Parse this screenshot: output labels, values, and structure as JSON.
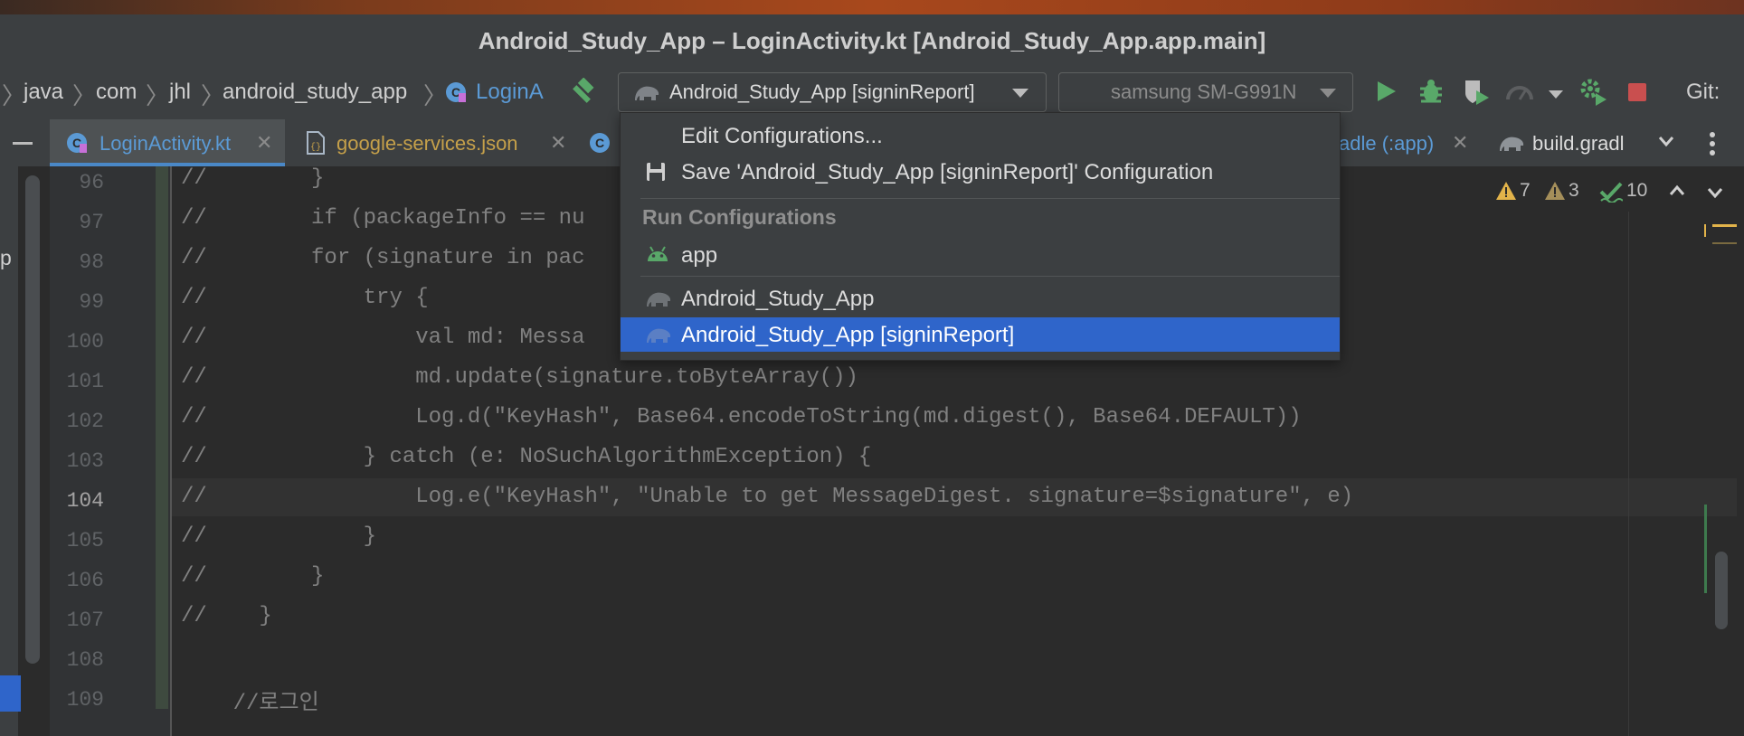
{
  "window": {
    "title": "Android_Study_App – LoginActivity.kt [Android_Study_App.app.main]"
  },
  "breadcrumb": [
    "java",
    "com",
    "jhl",
    "android_study_app",
    "LoginA"
  ],
  "toolbar": {
    "run_config": "Android_Study_App [signinReport]",
    "device": "samsung SM-G991N",
    "git_label": "Git:"
  },
  "tabs": [
    {
      "label": "LoginActivity.kt"
    },
    {
      "label": "google-services.json"
    },
    {
      "label": "adle (:app)"
    },
    {
      "label": "build.gradl"
    }
  ],
  "inspections": {
    "warnings": "7",
    "weak_warnings": "3",
    "ok": "10"
  },
  "side_label": "p",
  "dropdown": {
    "edit_configurations": "Edit Configurations...",
    "save_configuration": "Save 'Android_Study_App [signinReport]' Configuration",
    "section_header": "Run Configurations",
    "items": [
      "app",
      "Android_Study_App",
      "Android_Study_App [signinReport]"
    ],
    "selected_index": 2
  },
  "code": {
    "line_numbers": [
      "96",
      "97",
      "98",
      "99",
      "100",
      "101",
      "102",
      "103",
      "104",
      "105",
      "106",
      "107",
      "108",
      "109"
    ],
    "lines": [
      "//        }",
      "//        if (packageInfo == nu",
      "//        for (signature in pac",
      "//            try {",
      "//                val md: Messa",
      "//                md.update(signature.toByteArray())",
      "//                Log.d(\"KeyHash\", Base64.encodeToString(md.digest(), Base64.DEFAULT))",
      "//            } catch (e: NoSuchAlgorithmException) {",
      "//                Log.e(\"KeyHash\", \"Unable to get MessageDigest. signature=$signature\", e)",
      "//            }",
      "//        }",
      "//    }",
      "",
      "    //로그인"
    ],
    "current_line_index": 8
  },
  "colors": {
    "accent_blue": "#2f65ca",
    "run_green": "#59a869",
    "stop_red": "#c94f4f",
    "warning_yellow": "#e2b34a",
    "json_tab_orange": "#c5a04a",
    "kotlin_tab_blue": "#5b9ad5"
  }
}
